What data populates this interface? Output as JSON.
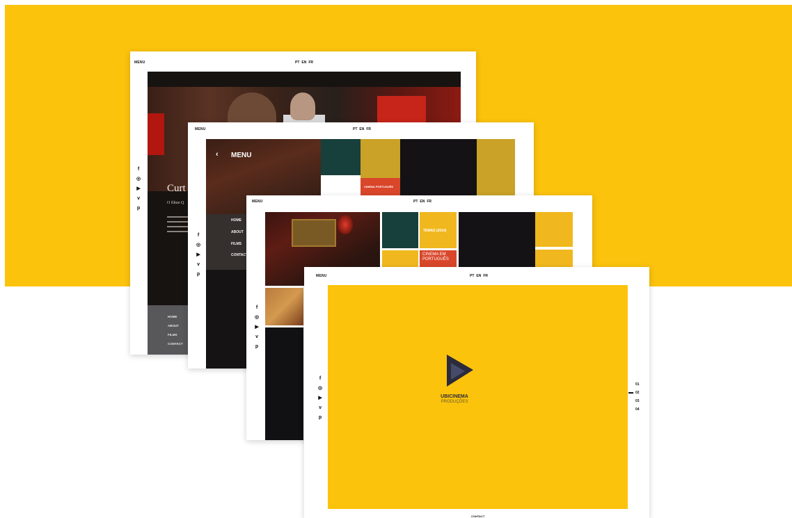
{
  "colors": {
    "brand_yellow": "#fbc30c",
    "dark": "#151313",
    "accent_red": "#d9462a"
  },
  "common": {
    "menu_label": "MENU",
    "languages": [
      "PT",
      "EN",
      "FR"
    ],
    "social_icons": [
      "facebook-icon",
      "instagram-icon",
      "youtube-icon",
      "vimeo-icon",
      "pinterest-icon"
    ],
    "social_glyphs": [
      "f",
      "◎",
      "▶",
      "v",
      "p"
    ]
  },
  "card1": {
    "title": "Curt",
    "subtitle": "O filme Q",
    "nav": [
      "HOME",
      "ABOUT",
      "FILMS",
      "CONTACT"
    ]
  },
  "card2": {
    "menu_title": "MENU",
    "nav": [
      "HOME",
      "ABOUT",
      "FILMS",
      "CONTACT"
    ],
    "tile_text": "CINEMA PORTUGUÊS"
  },
  "card3": {
    "tile_temas": "TEMAS (2014)",
    "tile_cinema": "CINEMA EM PORTUGUÊS"
  },
  "card4": {
    "brand_line1": "UBICINEMA",
    "brand_line2": "PRODUÇÕES",
    "pager": [
      "01",
      "02",
      "03",
      "04"
    ],
    "contact": "CONTACT"
  }
}
